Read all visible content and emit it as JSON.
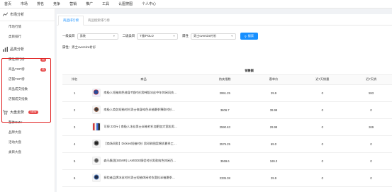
{
  "top_nav": [
    "首页",
    "市场",
    "排名",
    "竞争",
    "营销",
    "推广",
    "工具",
    "认图搜图",
    "个人中心"
  ],
  "sidebar": {
    "groups": [
      {
        "title": "市场分析",
        "icon": "trend-icon",
        "items": [
          {
            "label": "市场行情",
            "badge": ""
          },
          {
            "label": "类目排行",
            "badge": ""
          }
        ]
      },
      {
        "title": "品类分析",
        "icon": "chart-icon",
        "items": [
          {
            "label": "属性排行榜",
            "badge": "新"
          },
          {
            "label": "商品TOP榜",
            "badge": "新"
          },
          {
            "label": "店铺TOP榜",
            "badge": ""
          },
          {
            "label": "商品成交指数",
            "badge": ""
          },
          {
            "label": "店铺成交指数",
            "badge": ""
          }
        ]
      },
      {
        "title": "大盘走势",
        "icon": "cart-icon",
        "badge": "NEW",
        "items": [
          {
            "label": "整体GMV"
          },
          {
            "label": "品牌大盘"
          },
          {
            "label": "活动大盘"
          },
          {
            "label": "类目大盘"
          }
        ]
      }
    ]
  },
  "tabs": [
    {
      "label": "商品排行榜",
      "active": true
    },
    {
      "label": "商品搜索排行榜",
      "active": false
    }
  ],
  "filters": {
    "cat1_label": "一级类目",
    "cat1_value": "男装",
    "cat2_label": "二级类目",
    "cat2_value": "T恤/POLO",
    "attr_label": "属性",
    "attr_value": "男士oversize衬衫",
    "search_label": "搜索"
  },
  "attr_line": "属性：男士oversize衬衫",
  "table": {
    "group_header": "销售额",
    "columns": [
      "排名",
      "商品",
      "热卖指数",
      "客单价",
      "近7天销量",
      "近7天销"
    ],
    "rows": [
      {
        "rank": "1",
        "name": "南极人短袖纯色修身T恤衬衫男韩版冰丝中年休闲风衣夏季",
        "heat": "3991.25",
        "price": "29.9",
        "sales7": "0",
        "sales7b": "593"
      },
      {
        "rank": "2",
        "name": "南极人商务短袖衬衫男士修身纯色半袖夏季薄款衬衫外套上衣",
        "heat": "3606.7",
        "price": "39.99",
        "sales7": "0",
        "sales7b": "0"
      },
      {
        "rank": "3",
        "name": "可探 220斤 | 南极人冰丝男士半袖衬衫加肥加大宽松男装夏季",
        "heat": "3590.63",
        "price": "29.99",
        "sales7": "0",
        "sales7b": "269"
      },
      {
        "rank": "4",
        "name": "【商场同款】Dickies短袖衬衫 男印刷图案棉质夏季工装衬衫",
        "heat": "3576.25",
        "price": "69.0",
        "sales7": "0",
        "sales7b": "0"
      },
      {
        "rank": "5",
        "name": "森马集团(SEMIR) LAMODE情侣衬衫男款纯色休闲百搭衬衫潮",
        "heat": "3569.6",
        "price": "169.0",
        "sales7": "0",
        "sales7b": "0"
      },
      {
        "rank": "6",
        "name": "探险者品牌冰丝衬衫男士短袖休闲衬衣宽松半袖夏季薄款上衣",
        "heat": "3335.38",
        "price": "29.9",
        "sales7": "0",
        "sales7b": "0"
      }
    ]
  }
}
